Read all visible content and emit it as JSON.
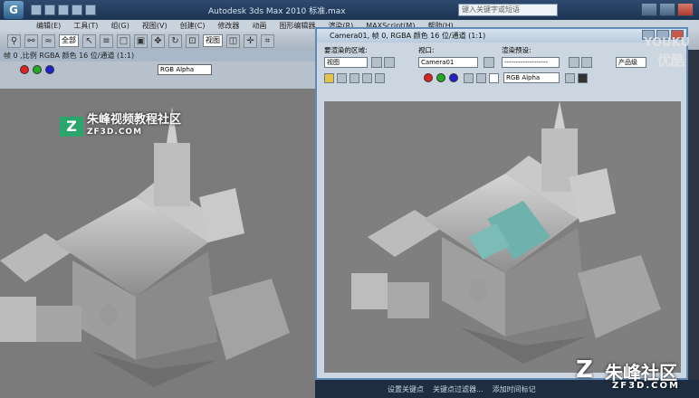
{
  "app": {
    "title": "Autodesk 3ds Max 2010   标准.max",
    "logo_label": "G",
    "search_placeholder": "键入关键字或短语"
  },
  "menu": [
    "编辑(E)",
    "工具(T)",
    "组(G)",
    "视图(V)",
    "创建(C)",
    "修改器",
    "动画",
    "图形编辑器",
    "渲染(R)",
    "MAXScript(M)",
    "帮助(H)"
  ],
  "toolbar": {
    "selection_filter": "全部",
    "ref_coord": "视图"
  },
  "left_frame": {
    "caption": "帧 0 ,比例 RGBA 颜色 16 位/通道 (1:1)",
    "channel": "RGB Alpha"
  },
  "right_frame": {
    "title": "Camera01, 帧 0, RGBA 颜色 16 位/通道 (1:1)",
    "label_area": "要渲染的区域:",
    "label_viewport": "视口:",
    "label_preset": "渲染预设:",
    "area_value": "视图",
    "viewport_value": "Camera01",
    "preset_value": "-------------------",
    "product_label": "产品级",
    "channel": "RGB Alpha"
  },
  "taskbar": {
    "items": [
      "设置关键点",
      "关键点过滤器...",
      "添加时间标记"
    ]
  },
  "watermarks": {
    "youku": "YOUKU",
    "youku_cn": "优酷",
    "zf_cn": "朱峰视频教程社区",
    "zf_sub": "ZF3D.COM",
    "zf_logo": "Z",
    "zf_brand": "朱峰社区",
    "zf_url": "ZF3D.COM"
  },
  "colors": {
    "accent": "#5e8ab5",
    "viewport_bg": "#7f7f7f"
  }
}
